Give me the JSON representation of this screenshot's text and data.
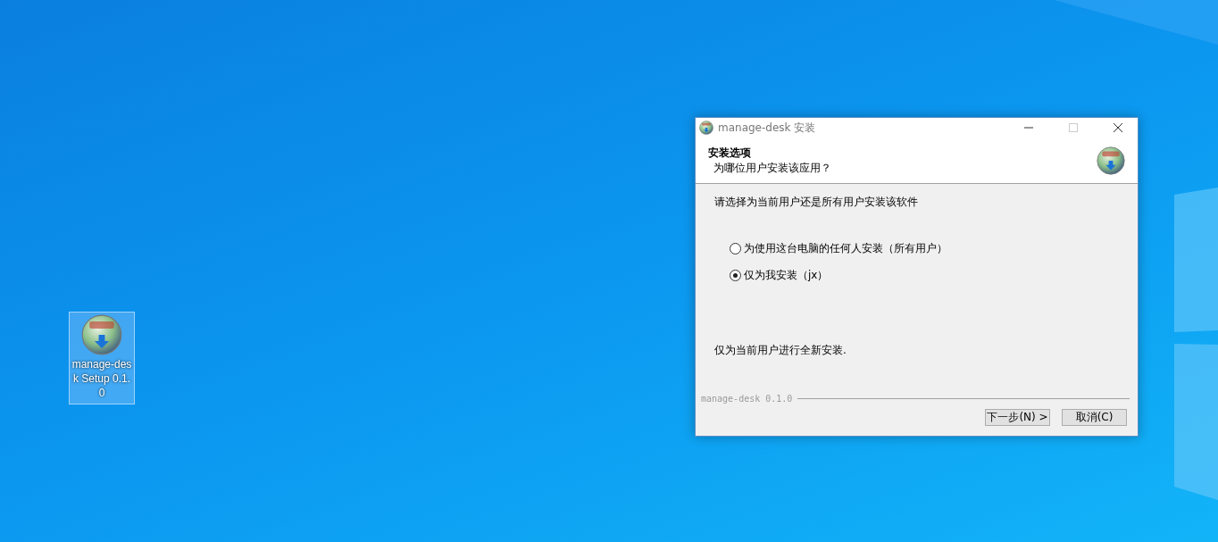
{
  "desktop_icon": {
    "label": "manage-desk Setup 0.1.0",
    "selected": true
  },
  "window": {
    "title": "manage-desk 安装",
    "header": {
      "title": "安装选项",
      "subtitle": "为哪位用户安装该应用？"
    },
    "prompt": "请选择为当前用户还是所有用户安装该软件",
    "options": [
      {
        "label": "为使用这台电脑的任何人安装（所有用户）",
        "selected": false
      },
      {
        "label": "仅为我安装（jx）",
        "selected": true
      }
    ],
    "note": "仅为当前用户进行全新安装.",
    "branding": "manage-desk 0.1.0",
    "buttons": [
      "下一步(N) >",
      "取消(C)"
    ]
  }
}
